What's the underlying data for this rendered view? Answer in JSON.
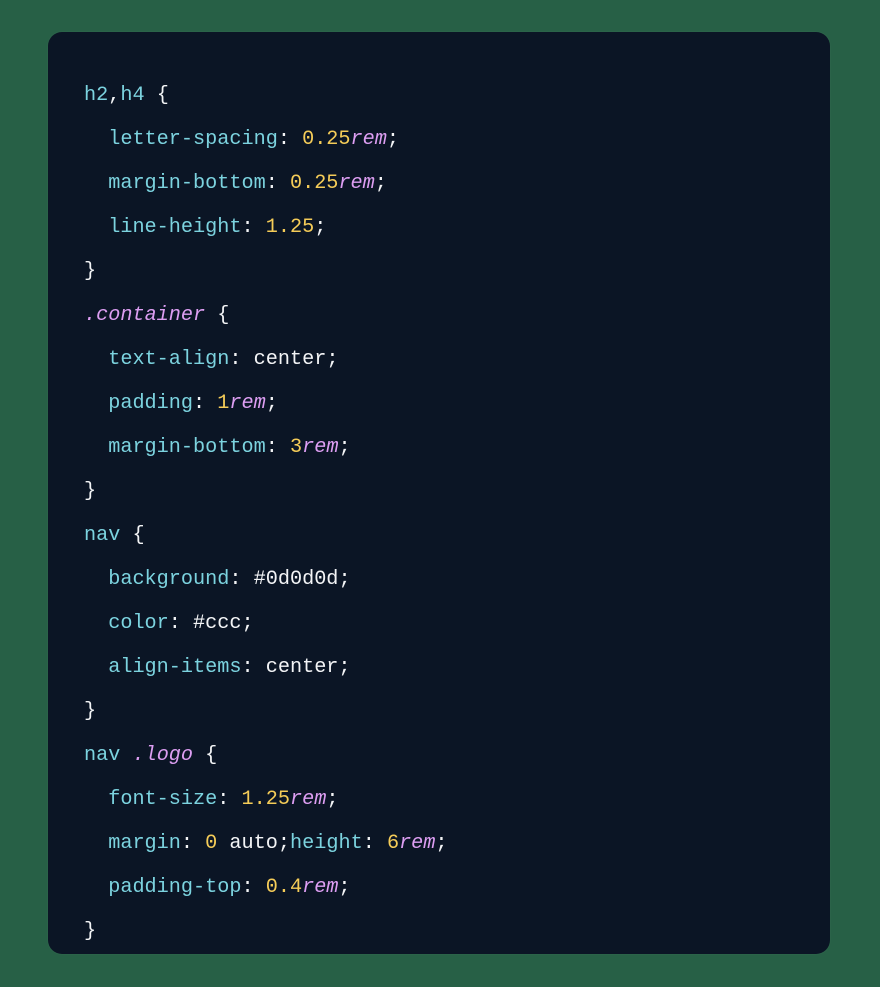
{
  "lines": {
    "l1": {
      "sel1": "h2",
      "comma": ",",
      "sel2": "h4",
      "sp": " ",
      "ob": "{"
    },
    "l2": {
      "prop": "letter-spacing",
      "colon": ":",
      "sp": " ",
      "num": "0.25",
      "unit": "rem",
      "semi": ";"
    },
    "l3": {
      "prop": "margin-bottom",
      "colon": ":",
      "sp": " ",
      "num": "0.25",
      "unit": "rem",
      "semi": ";"
    },
    "l4": {
      "prop": "line-height",
      "colon": ":",
      "sp": " ",
      "num": "1.25",
      "semi": ";"
    },
    "l5": {
      "cb": "}"
    },
    "l6": {
      "cls": ".container",
      "sp": " ",
      "ob": "{"
    },
    "l7": {
      "prop": "text-align",
      "colon": ":",
      "sp": " ",
      "val": "center",
      "semi": ";"
    },
    "l8": {
      "prop": "padding",
      "colon": ":",
      "sp": " ",
      "num": "1",
      "unit": "rem",
      "semi": ";"
    },
    "l9": {
      "prop": "margin-bottom",
      "colon": ":",
      "sp": " ",
      "num": "3",
      "unit": "rem",
      "semi": ";"
    },
    "l10": {
      "cb": "}"
    },
    "l11": {
      "sel": "nav",
      "sp": " ",
      "ob": "{"
    },
    "l12": {
      "prop": "background",
      "colon": ":",
      "sp": " ",
      "val": "#0d0d0d",
      "semi": ";"
    },
    "l13": {
      "prop": "color",
      "colon": ":",
      "sp": " ",
      "val": "#ccc",
      "semi": ";"
    },
    "l14": {
      "prop": "align-items",
      "colon": ":",
      "sp": " ",
      "val": "center",
      "semi": ";"
    },
    "l15": {
      "cb": "}"
    },
    "l16": {
      "sel": "nav",
      "sp1": " ",
      "cls": ".logo",
      "sp2": " ",
      "ob": "{"
    },
    "l17": {
      "prop": "font-size",
      "colon": ":",
      "sp": " ",
      "num": "1.25",
      "unit": "rem",
      "semi": ";"
    },
    "l18": {
      "prop1": "margin",
      "colon1": ":",
      "sp1": " ",
      "num1": "0",
      "sp2": " ",
      "val1": "auto",
      "semi1": ";",
      "prop2": "height",
      "colon2": ":",
      "sp3": " ",
      "num2": "6",
      "unit2": "rem",
      "semi2": ";"
    },
    "l19": {
      "prop": "padding-top",
      "colon": ":",
      "sp": " ",
      "num": "0.4",
      "unit": "rem",
      "semi": ";"
    },
    "l20": {
      "cb": "}"
    }
  }
}
